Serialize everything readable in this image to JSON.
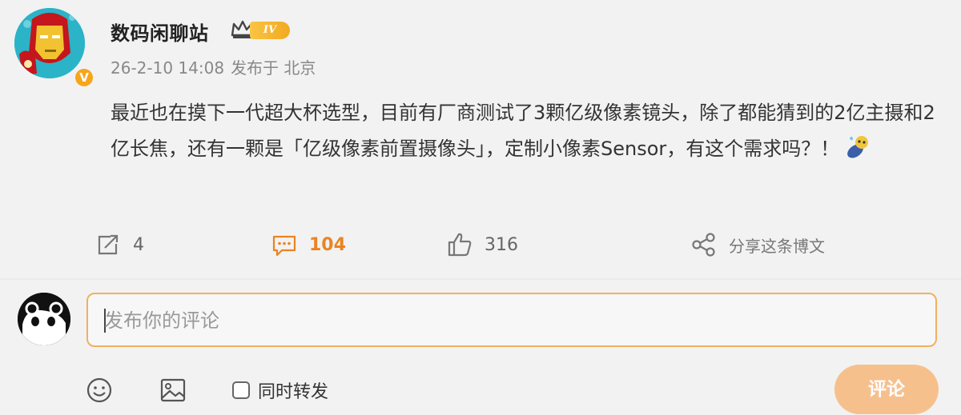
{
  "post": {
    "author": "数码闲聊站",
    "level_badge": "IV",
    "verified_mark": "V",
    "time": "26-2-10 14:08",
    "location": "发布于 北京",
    "content": "最近也在摸下一代超大杯选型，目前有厂商测试了3颗亿级像素镜头，除了都能猜到的2亿主摄和2亿长焦，还有一颗是「亿级像素前置摄像头」，定制小像素Sensor，有这个需求吗？！",
    "content_emoji": "sweat-drop-doge-emoji"
  },
  "actions": {
    "repost_count": "4",
    "comment_count": "104",
    "like_count": "316",
    "share_label": "分享这条博文"
  },
  "composer": {
    "placeholder": "发布你的评论",
    "sync_label": "同时转发",
    "submit_label": "评论"
  },
  "icons": {
    "repost": "repost-icon",
    "comment": "comment-icon",
    "like": "like-icon",
    "share": "share-icon",
    "emoji": "emoji-icon",
    "image": "image-icon",
    "crown": "crown-icon"
  },
  "colors": {
    "accent": "#e98422",
    "input_border": "#f0b063",
    "submit_bg": "#f6c08d",
    "level_badge": "#f3a91f",
    "background": "#f2f2f2"
  }
}
